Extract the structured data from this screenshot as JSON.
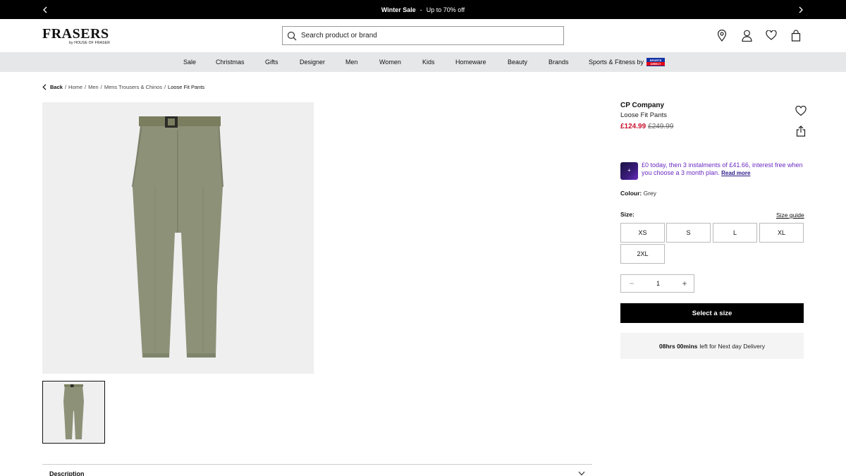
{
  "promo": {
    "title": "Winter Sale",
    "separator": "-",
    "detail": "Up to 70% off"
  },
  "header": {
    "logo": "FRASERS",
    "logo_sub": "by HOUSE OF FRASER",
    "search_placeholder": "Search product or brand",
    "icons": [
      "location-icon",
      "account-icon",
      "wishlist-icon",
      "bag-icon"
    ]
  },
  "nav": {
    "items": [
      "Sale",
      "Christmas",
      "Gifts",
      "Designer",
      "Men",
      "Women",
      "Kids",
      "Homeware",
      "Beauty",
      "Brands",
      "Sports & Fitness by"
    ],
    "badge_top": "SPORTS",
    "badge_bottom": "DIRECT"
  },
  "breadcrumb": {
    "back": "Back",
    "items": [
      "Home",
      "Men",
      "Mens Trousers & Chinos"
    ],
    "current": "Loose Fit Pants"
  },
  "product": {
    "brand": "CP Company",
    "name": "Loose Fit Pants",
    "price_now": "£124.99",
    "price_was": "£249.99",
    "klarna_text": "£0 today, then 3 instalments of £41.66, interest free when you choose a 3 month plan.",
    "klarna_link": "Read more",
    "colour_label": "Colour:",
    "colour_value": "Grey",
    "size_label": "Size:",
    "size_guide": "Size guide",
    "sizes": [
      "XS",
      "S",
      "L",
      "XL",
      "2XL"
    ],
    "quantity": "1",
    "qty_minus": "−",
    "qty_plus": "+",
    "cta": "Select a size",
    "delivery_time": "08hrs 00mins",
    "delivery_text": "left for Next day Delivery"
  },
  "description": {
    "label": "Description"
  },
  "colors": {
    "promo_bg": "#000000",
    "nav_bg": "#e6e7e8",
    "price_sale": "#c8102e",
    "klarna_purple": "#6a2bc2",
    "cta_bg": "#000000",
    "product_green": "#8c9178"
  }
}
